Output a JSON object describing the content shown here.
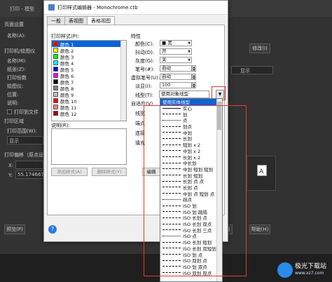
{
  "background": {
    "window_title": "打印 - 模型",
    "page_setup": "页面设置",
    "name_label": "名称(A):",
    "printer_section": "打印机/绘图仪",
    "printer_fields": [
      "名称(M):",
      "纸张(Z):",
      "打印份数",
      "绘图仪:",
      "位置:",
      "说明:"
    ],
    "print_to_file": "打印到文件",
    "print_area": "打印区域",
    "print_range": "打印范围(W):",
    "print_range_value": "显示",
    "offset_label": "打印偏移（原点设",
    "offset_x_label": "X:",
    "offset_y_label": "Y:",
    "offset_y_value": "55.174667",
    "preview_button": "预览(P)",
    "display_value": "显示",
    "modify_button": "修改(I)",
    "apply_button": "用",
    "help_button": "帮助(H)"
  },
  "dialog": {
    "title": "打印样式编辑器 - Monochrome.ctb",
    "tabs": [
      "一般",
      "表视图",
      "表格视图"
    ],
    "active_tab": 2,
    "print_styles_label": "打印样式(P):",
    "styles": [
      {
        "label": "颜色 1",
        "color": "#ff0000"
      },
      {
        "label": "颜色 2",
        "color": "#ffff00"
      },
      {
        "label": "颜色 3",
        "color": "#00ff00"
      },
      {
        "label": "颜色 4",
        "color": "#00ffff"
      },
      {
        "label": "颜色 5",
        "color": "#0000ff"
      },
      {
        "label": "颜色 6",
        "color": "#ff00ff"
      },
      {
        "label": "颜色 7",
        "color": "#000000"
      },
      {
        "label": "颜色 8",
        "color": "#808080"
      },
      {
        "label": "颜色 9",
        "color": "#c0c0c0"
      },
      {
        "label": "颜色 10",
        "color": "#ff0000"
      },
      {
        "label": "颜色 11",
        "color": "#ff7f7f"
      },
      {
        "label": "颜色 12",
        "color": "#a50000"
      }
    ],
    "description_label": "说明(R):",
    "add_style_button": "添加样式(A)",
    "delete_style_button": "删除样式(Y)",
    "edit_button": "编辑",
    "properties_label": "特性",
    "props": [
      {
        "label": "颜色(C):",
        "value": "■ 黑"
      },
      {
        "label": "抖动(D):",
        "value": "开"
      },
      {
        "label": "灰度(G):",
        "value": "关"
      },
      {
        "label": "笔号(#):",
        "value": "自动"
      },
      {
        "label": "虚拟笔号(U):",
        "value": "自动"
      },
      {
        "label": "淡显(I):",
        "value": "100"
      }
    ],
    "linetype_label": "线型(T):",
    "linetype_value": "使用对象线型",
    "adaptive_label": "自适应(V)",
    "other_labels": [
      "线宽",
      "端点",
      "连接",
      "填充"
    ],
    "help_icon": "help-icon"
  },
  "dropdown": {
    "items": [
      {
        "line": false,
        "label": "使用实体线型",
        "selected": true
      },
      {
        "line": true,
        "label": "实心"
      },
      {
        "line": true,
        "label": "划"
      },
      {
        "line": true,
        "label": "点"
      },
      {
        "line": true,
        "label": "划点"
      },
      {
        "line": true,
        "label": "中划"
      },
      {
        "line": true,
        "label": "长划"
      },
      {
        "line": true,
        "label": "短划 x 2"
      },
      {
        "line": true,
        "label": "中划 x 2"
      },
      {
        "line": true,
        "label": "长划 x 2"
      },
      {
        "line": true,
        "label": "中长划"
      },
      {
        "line": true,
        "label": "中划 短划 短划"
      },
      {
        "line": true,
        "label": "长划 短划"
      },
      {
        "line": true,
        "label": "长划 点 点"
      },
      {
        "line": true,
        "label": "长划 点"
      },
      {
        "line": true,
        "label": "中划 点 短划 点"
      },
      {
        "line": true,
        "label": "疏点"
      },
      {
        "line": true,
        "label": "ISO 划"
      },
      {
        "line": true,
        "label": "ISO 划 疏隔"
      },
      {
        "line": true,
        "label": "ISO 长划 点"
      },
      {
        "line": true,
        "label": "ISO 长划 双点"
      },
      {
        "line": true,
        "label": "ISO 长划 三点"
      },
      {
        "line": true,
        "label": "ISO 点"
      },
      {
        "line": true,
        "label": "ISO 长划 短划"
      },
      {
        "line": true,
        "label": "ISO 长划 双短划"
      },
      {
        "line": true,
        "label": "ISO 划 点"
      },
      {
        "line": true,
        "label": "ISO 双划 点"
      },
      {
        "line": true,
        "label": "ISO 划 双点"
      },
      {
        "line": true,
        "label": "ISO 双划 双点"
      }
    ]
  },
  "watermark": {
    "brand": "极光下载站",
    "url": "www.xz7.com"
  }
}
